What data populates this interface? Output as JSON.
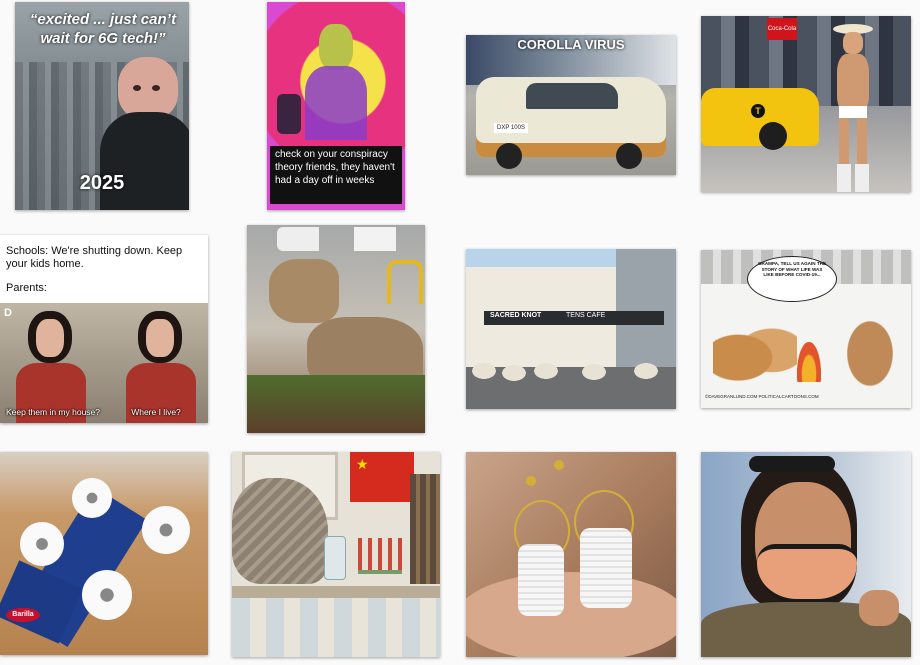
{
  "grid": {
    "tiles": [
      {
        "id": "6g",
        "quote": "“excited ... just can’t wait for 6G tech!”",
        "year": "2025"
      },
      {
        "id": "conspiracy",
        "caption": "check on your conspiracy theory friends, they haven't had a day off in weeks"
      },
      {
        "id": "corolla",
        "caption": "COROLLA VIRUS",
        "plate": "DXP 100S"
      },
      {
        "id": "naked-cowboy",
        "sign": "Coca-Cola",
        "taxi_badge": "T"
      },
      {
        "id": "schools",
        "line1": "Schools: We're shutting down. Keep your kids home.",
        "line2": "Parents:",
        "sub_left": "Keep them in my house?",
        "sub_right": "Where I live?",
        "logo": "D"
      },
      {
        "id": "deer"
      },
      {
        "id": "sheep",
        "shop1": "SACRED KNOT",
        "shop2": "TENS CAFE"
      },
      {
        "id": "cavemen",
        "bubble": "GRAMPA, TELL US AGAIN THE STORY OF WHAT LIFE WAS LIKE BEFORE COVID-19...",
        "credit": "©DAVEGRANLUND.COM POLITICALCARTOONS.COM"
      },
      {
        "id": "pasta-car",
        "brand": "Barilla"
      },
      {
        "id": "cat-lab"
      },
      {
        "id": "tp-earrings"
      },
      {
        "id": "mask-woman"
      }
    ]
  }
}
